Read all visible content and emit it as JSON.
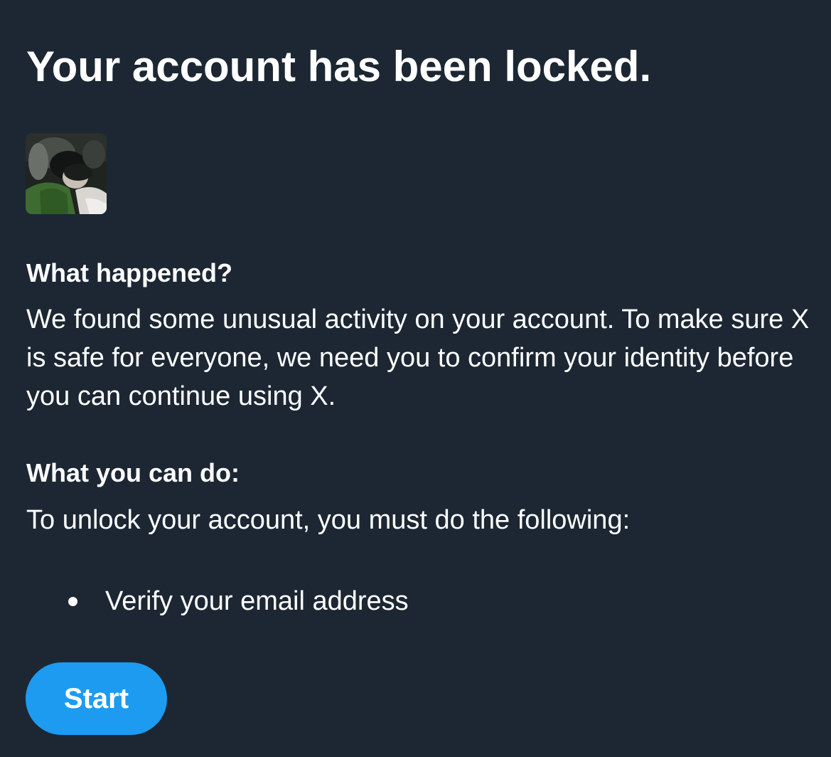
{
  "page": {
    "title": "Your account has been locked."
  },
  "avatar": {
    "icon": "profile-photo"
  },
  "sections": {
    "happened": {
      "heading": "What happened?",
      "body": "We found some unusual activity on your account. To make sure X is safe for everyone, we need you to confirm your identity before you can continue using X."
    },
    "cando": {
      "heading": "What you can do:",
      "body": "To unlock your account, you must do the following:",
      "steps": [
        "Verify your email address"
      ]
    }
  },
  "actions": {
    "start_label": "Start"
  },
  "colors": {
    "background": "#1c2733",
    "text": "#ffffff",
    "accent": "#1d9bf0"
  }
}
